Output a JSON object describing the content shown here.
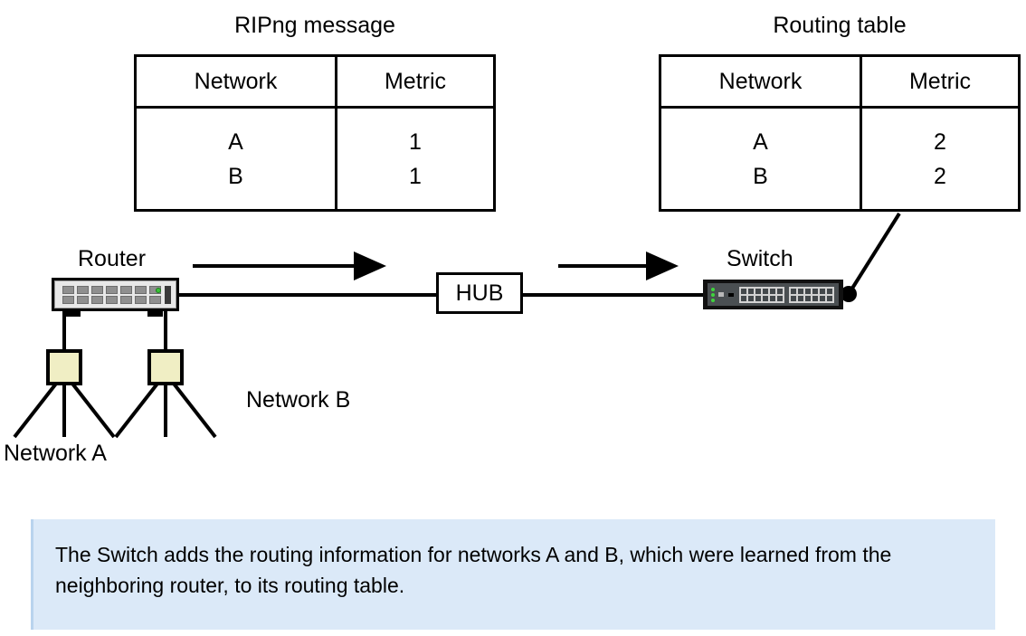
{
  "diagram": {
    "title_left": "RIPng message",
    "title_right": "Routing table",
    "tables": {
      "ripng": {
        "name": "RIPng message",
        "columns": [
          "Network",
          "Metric"
        ],
        "rows": [
          {
            "network": "A",
            "metric": "1"
          },
          {
            "network": "B",
            "metric": "1"
          }
        ]
      },
      "routing": {
        "name": "Routing table",
        "columns": [
          "Network",
          "Metric"
        ],
        "rows": [
          {
            "network": "A",
            "metric": "2"
          },
          {
            "network": "B",
            "metric": "2"
          }
        ]
      }
    },
    "nodes": {
      "router_label": "Router",
      "hub_label": "HUB",
      "switch_label": "Switch",
      "network_a_label": "Network A",
      "network_b_label": "Network B"
    },
    "caption": "The Switch adds the routing information for networks A and B, which were learned from the neighboring router, to its routing table.",
    "colors": {
      "line": "#000000",
      "network_segment_fill": "#f0eec4",
      "caption_background": "#dbe9f8",
      "caption_border": "#b9d3ee",
      "router_body": "#e8e8e8",
      "switch_body": "#4a4f52",
      "led_green": "#3fd43d"
    }
  }
}
